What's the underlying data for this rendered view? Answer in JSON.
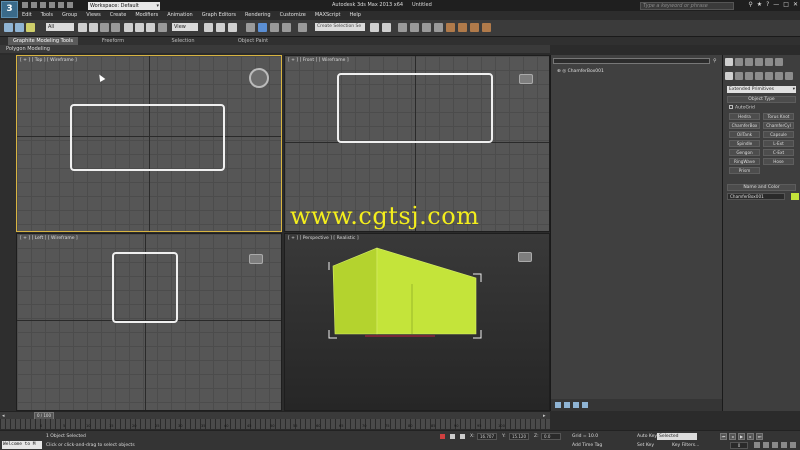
{
  "app": {
    "logo": "3",
    "workspace": "Workspace: Default",
    "title": "Autodesk 3ds Max 2013 x64",
    "file": "Untitled",
    "search_placeholder": "Type a keyword or phrase"
  },
  "menu": [
    "Edit",
    "Tools",
    "Group",
    "Views",
    "Create",
    "Modifiers",
    "Animation",
    "Graph Editors",
    "Rendering",
    "Customize",
    "MAXScript",
    "Help"
  ],
  "toolbar": {
    "filter": "All",
    "view": "View",
    "selection_set_placeholder": "Create Selection Se"
  },
  "ribbon": {
    "tabs": [
      "Graphite Modeling Tools",
      "Freeform",
      "Selection",
      "Object Paint"
    ],
    "subpanel": "Polygon Modeling"
  },
  "viewports": {
    "top": "[ + ] [ Top ] [ Wireframe ]",
    "front": "[ + ] [ Front ] [ Wireframe ]",
    "left": "[ + ] [ Left ] [ Wireframe ]",
    "perspective": "[ + ] [ Perspective ] [ Realistic ]"
  },
  "explorer": {
    "item": "ChamferBox001"
  },
  "command_panel": {
    "category": "Extended Primitives",
    "object_type_title": "Object Type",
    "autogrid": "AutoGrid",
    "buttons": [
      "Hedra",
      "Torus Knot",
      "ChamferBox",
      "ChamferCyl",
      "OilTank",
      "Capsule",
      "Spindle",
      "L-Ext",
      "Gengon",
      "C-Ext",
      "RingWave",
      "Hose",
      "Prism"
    ],
    "name_color_title": "Name and Color",
    "object_name": "ChamferBox001",
    "swatch_color": "#c4e43a"
  },
  "timeline": {
    "frame": "0 / 100",
    "ticks": [
      "0",
      "5",
      "10",
      "15",
      "20",
      "25",
      "30",
      "35",
      "40",
      "45",
      "50",
      "55",
      "60",
      "65",
      "70",
      "75",
      "80",
      "85",
      "90",
      "95",
      "100"
    ]
  },
  "status": {
    "listener": "Welcome to M",
    "selected": "1 Object Selected",
    "prompt": "Click or click-and-drag to select objects",
    "x_label": "X:",
    "x_value": "16.707",
    "y_label": "Y:",
    "y_value": "15.120",
    "z_label": "Z:",
    "z_value": "0.0",
    "grid": "Grid = 10.0",
    "add_time_tag": "Add Time Tag",
    "auto_key": "Auto Key",
    "selected_dd": "Selected",
    "set_key": "Set Key",
    "key_filters": "Key Filters...",
    "current_frame": "0"
  },
  "watermark": "www.cgtsj.com",
  "colors": {
    "object": "#c4e43a",
    "active_viewport": "#d8b441",
    "watermark": "#f4ee1c"
  }
}
